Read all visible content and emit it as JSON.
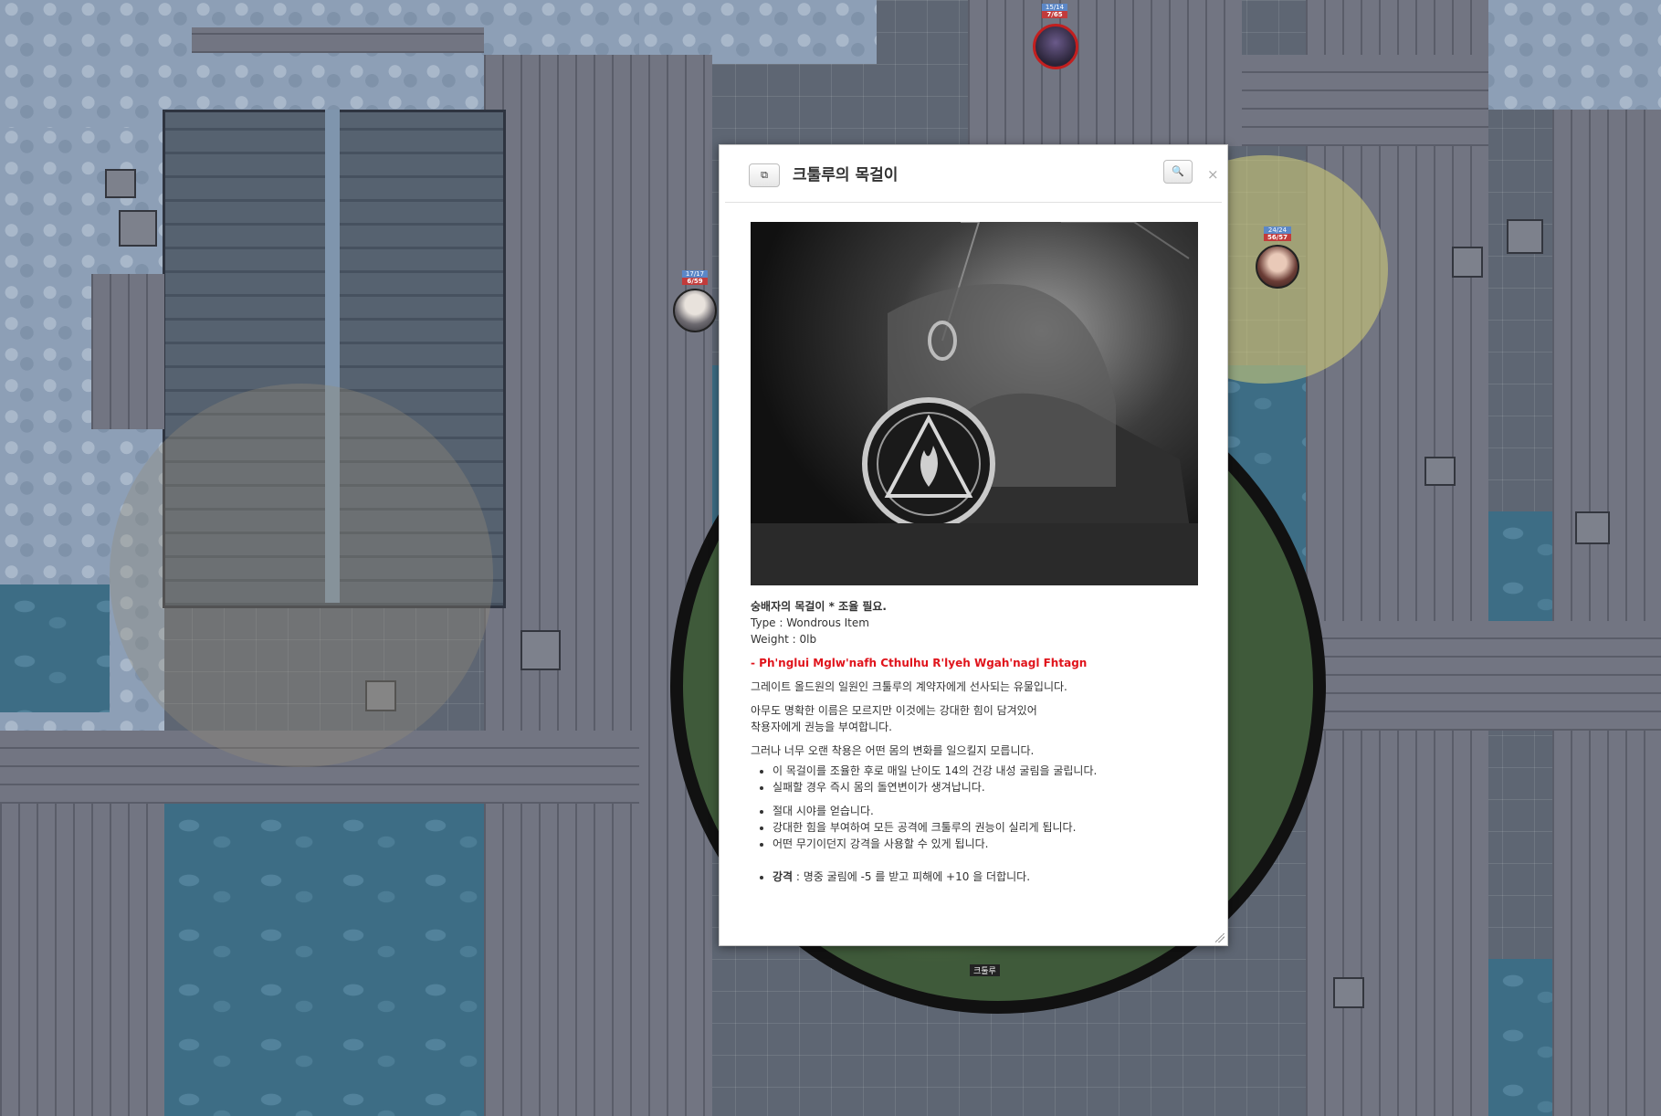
{
  "tokens": [
    {
      "id": "top",
      "bar1": "15/14",
      "bar2": "7/65"
    },
    {
      "id": "left",
      "bar1": "17/17",
      "bar2": "6/59"
    },
    {
      "id": "right",
      "bar1": "24/24",
      "bar2": "56/57"
    }
  ],
  "well_label": "크툴루",
  "dialog": {
    "title": "크툴루의 목걸이",
    "popout_icon": "popout-icon",
    "search_icon": "search-icon",
    "close_symbol": "×",
    "image_alt": "pendant-image",
    "line_name": "숭배자의 목걸이 * 조율 필요.",
    "line_type": "Type : Wondrous Item",
    "line_weight": "Weight : 0lb",
    "incantation": "- Ph'nglui Mglw'nafh Cthulhu R'lyeh Wgah'nagl Fhtagn",
    "para1": "그레이트 올드원의 일원인 크툴루의 계약자에게 선사되는 유물입니다.",
    "para2_line1": "아무도 명확한 이름은 모르지만 이것에는 강대한 힘이 담겨있어",
    "para2_line2": "착용자에게 권능을 부여합니다.",
    "para3": "그러나 너무 오랜 착용은 어떤 몸의 변화를 일으킬지 모릅니다.",
    "list1": [
      "이 목걸이를 조율한 후로 매일 난이도 14의 건강 내성 굴림을 굴립니다.",
      "실패할 경우 즉시 몸의 돌연변이가 생겨납니다."
    ],
    "list2": [
      "절대 시야를 얻습니다.",
      "강대한 힘을 부여하여 모든 공격에 크툴루의 권능이 실리게 됩니다.",
      "어떤 무기이던지 강격을 사용할 수 있게 됩니다."
    ],
    "power_name": "강격",
    "power_desc": " : 명중 굴림에 -5 를 받고 피해에 +10 을 더합니다."
  }
}
